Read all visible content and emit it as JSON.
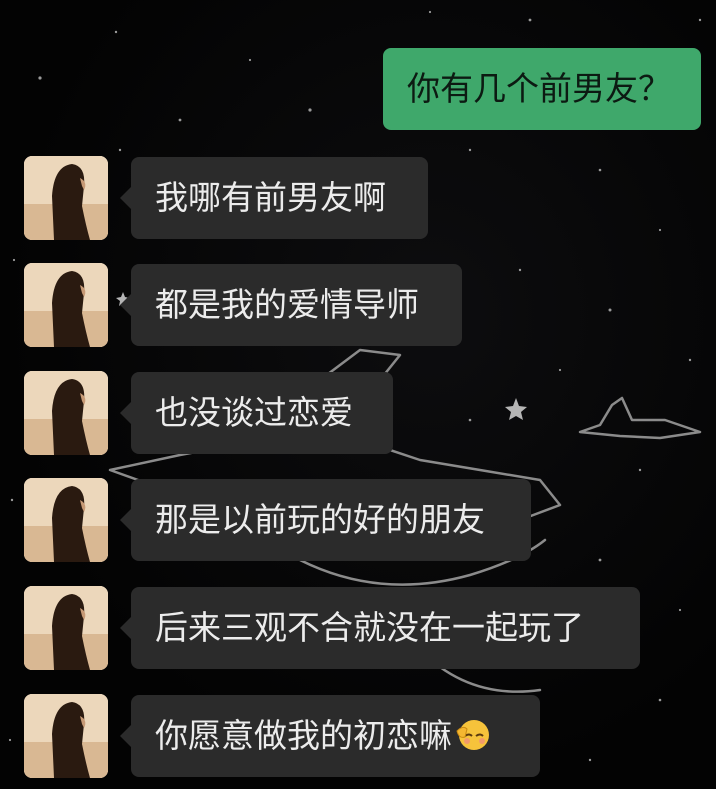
{
  "chat": {
    "outgoing": {
      "text": "你有几个前男友？"
    },
    "incoming": [
      {
        "text": "我哪有前男友啊"
      },
      {
        "text": "都是我的爱情导师"
      },
      {
        "text": "也没谈过恋爱"
      },
      {
        "text": "那是以前玩的好的朋友"
      },
      {
        "text": "后来三观不合就没在一起玩了"
      },
      {
        "text": "你愿意做我的初恋嘛",
        "emoji": "shy-face-emoji"
      }
    ]
  },
  "colors": {
    "background": "#050505",
    "outgoing_bubble": "#3fa86b",
    "incoming_bubble": "#2b2b2b",
    "incoming_text": "#ececec"
  }
}
